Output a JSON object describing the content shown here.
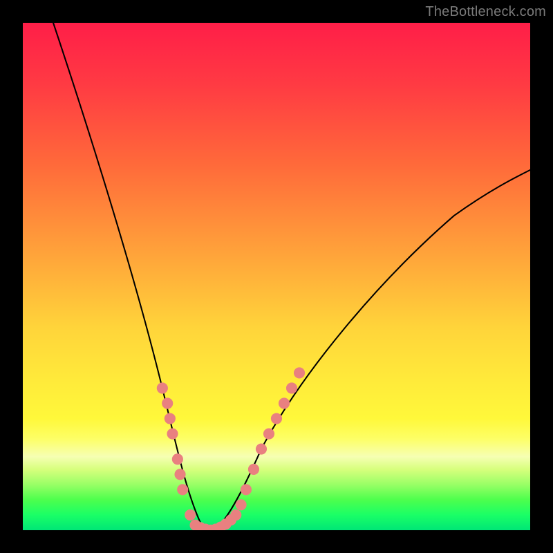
{
  "watermark": "TheBottleneck.com",
  "chart_data": {
    "type": "line",
    "title": "",
    "xlabel": "",
    "ylabel": "",
    "xlim": [
      0,
      100
    ],
    "ylim": [
      0,
      100
    ],
    "grid": false,
    "legend": false,
    "background_gradient": {
      "direction": "vertical",
      "stops": [
        {
          "pos": 0.0,
          "color": "#ff1e48"
        },
        {
          "pos": 0.28,
          "color": "#ff6a3a"
        },
        {
          "pos": 0.5,
          "color": "#ffb23a"
        },
        {
          "pos": 0.7,
          "color": "#ffe93a"
        },
        {
          "pos": 0.85,
          "color": "#f6ffb3"
        },
        {
          "pos": 0.92,
          "color": "#99ff66"
        },
        {
          "pos": 1.0,
          "color": "#00e676"
        }
      ]
    },
    "series": [
      {
        "name": "bottleneck-curve",
        "color": "#000000",
        "x": [
          6,
          10,
          14,
          18,
          22,
          25,
          27,
          29,
          31,
          33,
          35,
          37,
          39,
          41,
          45,
          50,
          55,
          60,
          65,
          70,
          75,
          80,
          85,
          90,
          95,
          100
        ],
        "y": [
          100,
          88,
          76,
          64,
          50,
          38,
          30,
          20,
          10,
          4,
          1,
          0,
          1,
          4,
          12,
          22,
          31,
          38,
          44,
          49,
          54,
          58,
          62,
          65,
          68,
          71
        ]
      },
      {
        "name": "highlight-dots-left",
        "color": "#e98080",
        "type": "scatter",
        "x": [
          27.5,
          28.5,
          29.0,
          29.5,
          30.5,
          31.0,
          31.5,
          33.0,
          34.0
        ],
        "y": [
          28,
          25,
          22,
          19,
          14,
          11,
          8,
          3,
          1
        ]
      },
      {
        "name": "highlight-dots-bottom",
        "color": "#e98080",
        "type": "scatter",
        "x": [
          35.0,
          36.0,
          37.0,
          38.0,
          39.0,
          40.0,
          41.0,
          42.0
        ],
        "y": [
          0.5,
          0.2,
          0.0,
          0.2,
          0.6,
          1.2,
          2.0,
          3.0
        ]
      },
      {
        "name": "highlight-dots-right",
        "color": "#e98080",
        "type": "scatter",
        "x": [
          43.0,
          44.0,
          45.5,
          47.0,
          48.5,
          50.0,
          51.5,
          53.0,
          54.5
        ],
        "y": [
          5,
          8,
          12,
          16,
          19,
          22,
          25,
          28,
          31
        ]
      }
    ]
  }
}
